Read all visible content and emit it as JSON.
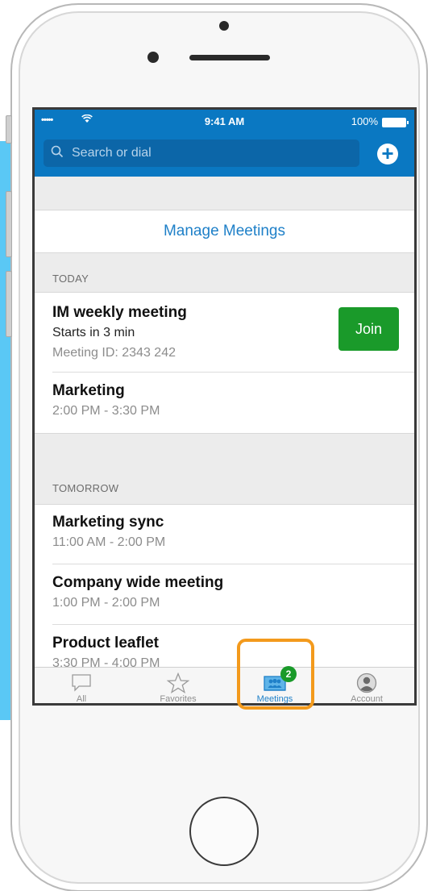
{
  "status_bar": {
    "signal": "•••••",
    "time": "9:41 AM",
    "battery": "100%"
  },
  "header": {
    "search_placeholder": "Search or dial"
  },
  "manage_meetings": "Manage Meetings",
  "sections": [
    {
      "title": "TODAY",
      "items": [
        {
          "title": "IM weekly meeting",
          "subtitle": "Starts in 3 min",
          "meta": "Meeting ID: 2343 242",
          "action": "Join"
        },
        {
          "title": "Marketing",
          "meta": "2:00 PM - 3:30 PM"
        }
      ]
    },
    {
      "title": "TOMORROW",
      "items": [
        {
          "title": "Marketing sync",
          "meta": "11:00 AM - 2:00 PM"
        },
        {
          "title": "Company wide meeting",
          "meta": "1:00 PM - 2:00 PM"
        },
        {
          "title": "Product leaflet",
          "meta": "3:30 PM - 4:00 PM"
        }
      ]
    }
  ],
  "tabs": [
    {
      "label": "All",
      "icon": "chat-bubble-icon"
    },
    {
      "label": "Favorites",
      "icon": "star-icon"
    },
    {
      "label": "Meetings",
      "icon": "meetings-icon",
      "badge": "2",
      "active": true
    },
    {
      "label": "Account",
      "icon": "account-icon"
    }
  ],
  "colors": {
    "header": "#0a78c2",
    "join": "#1a9a2a",
    "highlight": "#f39a1c",
    "accent_strip": "#5ac8f5"
  }
}
